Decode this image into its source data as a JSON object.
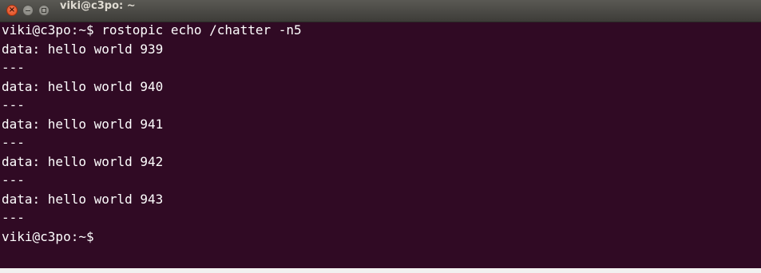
{
  "window": {
    "title": "viki@c3po: ~"
  },
  "terminal": {
    "lines": [
      "viki@c3po:~$ rostopic echo /chatter -n5",
      "data: hello world 939",
      "---",
      "data: hello world 940",
      "---",
      "data: hello world 941",
      "---",
      "data: hello world 942",
      "---",
      "data: hello world 943",
      "---",
      "viki@c3po:~$"
    ]
  },
  "colors": {
    "terminal_background": "#300a24",
    "terminal_text": "#ffffff",
    "titlebar": "#3d3c38",
    "close_button": "#df4a16"
  },
  "icons": {
    "close": "close-icon",
    "minimize": "minimize-icon",
    "maximize": "maximize-icon"
  }
}
